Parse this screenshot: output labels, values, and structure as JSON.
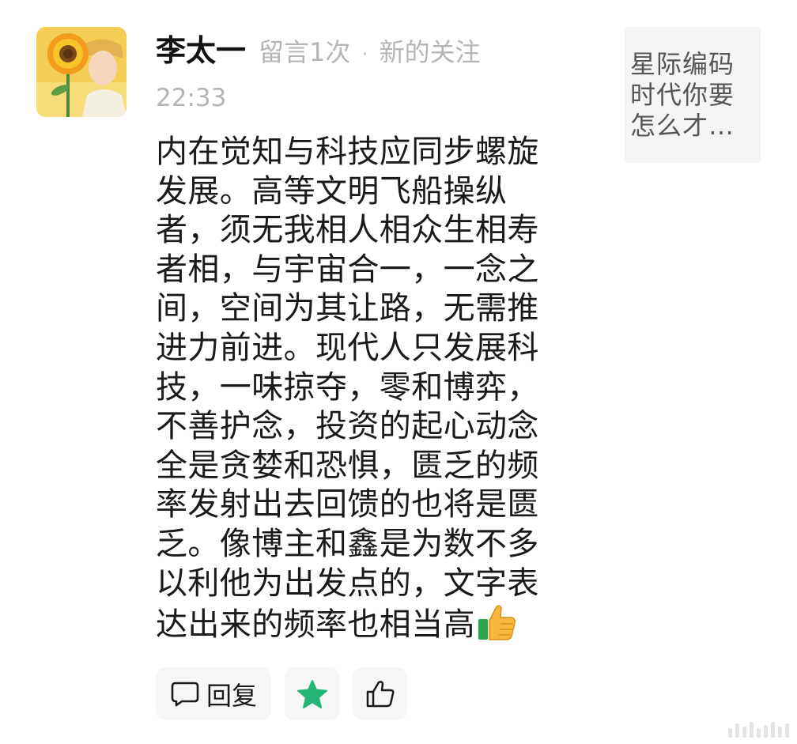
{
  "comment": {
    "author": "李太一",
    "meta": "留言1次",
    "separator": "·",
    "status": "新的关注",
    "time": "22:33",
    "text": "内在觉知与科技应同步螺旋发展。高等文明飞船操纵者，须无我相人相众生相寿者相，与宇宙合一，一念之间，空间为其让路，无需推进力前进。现代人只发展科技，一味掠夺，零和博弈，不善护念，投资的起心动念全是贪婪和恐惧，匮乏的频率发射出去回馈的也将是匮乏。像博主和鑫是为数不多以利他为出发点的，文字表达出来的频率也相当高",
    "emoji": "thumbs-up-icon"
  },
  "reference": {
    "preview": "星际编码时代你要怎么才…"
  },
  "actions": {
    "reply_label": "回复",
    "star_color": "#22b573",
    "icons": [
      "comment-bubble-icon",
      "star-icon",
      "thumbs-up-outline-icon"
    ]
  }
}
